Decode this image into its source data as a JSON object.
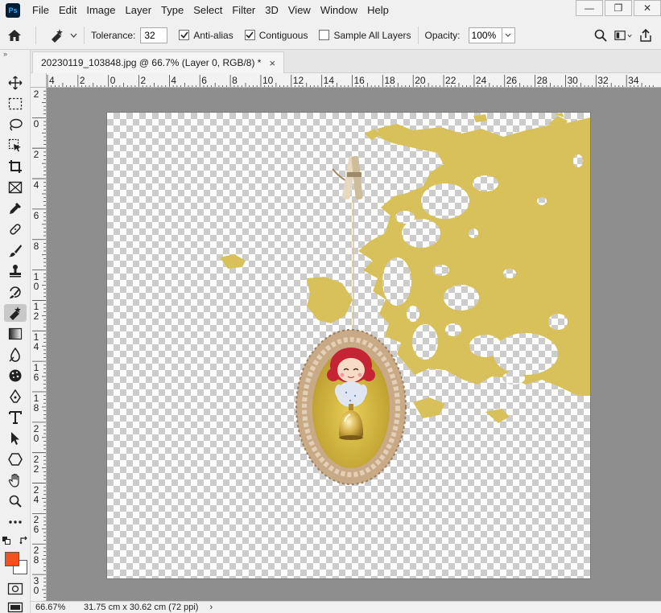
{
  "app": {
    "logo_text": "Ps",
    "menu": [
      "File",
      "Edit",
      "Image",
      "Layer",
      "Type",
      "Select",
      "Filter",
      "3D",
      "View",
      "Window",
      "Help"
    ],
    "window_controls": {
      "minimize": "—",
      "restore": "❐",
      "close": "✕"
    }
  },
  "options": {
    "tolerance_label": "Tolerance:",
    "tolerance_value": "32",
    "anti_alias_label": "Anti-alias",
    "anti_alias_checked": true,
    "contiguous_label": "Contiguous",
    "contiguous_checked": true,
    "sample_all_label": "Sample All Layers",
    "sample_all_checked": false,
    "opacity_label": "Opacity:",
    "opacity_value": "100%"
  },
  "document": {
    "tab_title": "20230119_103848.jpg @ 66.7% (Layer 0, RGB/8) *",
    "close_glyph": "×"
  },
  "rulers": {
    "top": [
      "4",
      "2",
      "0",
      "2",
      "4",
      "6",
      "8",
      "10",
      "12",
      "14",
      "16",
      "18",
      "20",
      "22",
      "24",
      "26",
      "28",
      "30",
      "32",
      "34"
    ],
    "left": [
      "2",
      "0",
      "2",
      "4",
      "6",
      "8",
      "1 0",
      "1 2",
      "1 4",
      "1 6",
      "1 8",
      "2 0",
      "2 2",
      "2 4",
      "2 6",
      "2 8",
      "3 0"
    ]
  },
  "colors": {
    "foreground": "#f4511e",
    "background": "#ffffff",
    "paint": "#d8c15a",
    "frame": "#c9ab8a"
  },
  "status": {
    "zoom": "66.67%",
    "doc_size": "31.75 cm x 30.62 cm (72 ppi)",
    "arrow": "›"
  }
}
